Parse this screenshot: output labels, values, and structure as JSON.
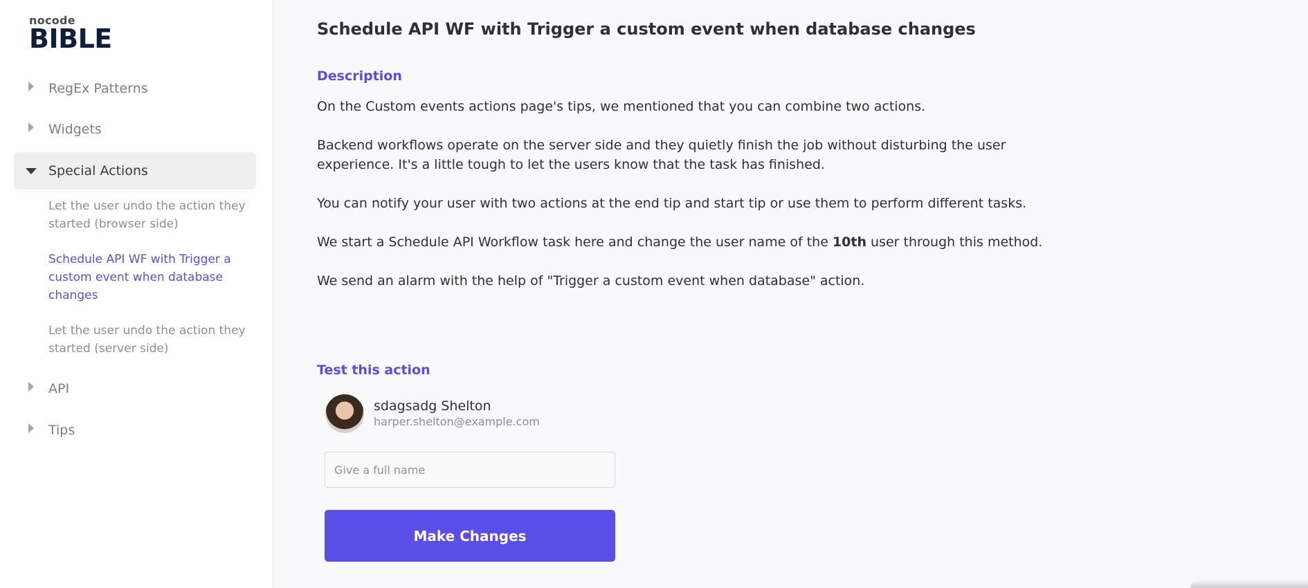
{
  "logo": {
    "small": "nocode",
    "big": "BIBLE"
  },
  "sidebar": {
    "items": [
      {
        "label": "RegEx Patterns",
        "expanded": false
      },
      {
        "label": "Widgets",
        "expanded": false
      },
      {
        "label": "Special Actions",
        "expanded": true,
        "children": [
          {
            "label": "Let the user undo the action they started (browser side)"
          },
          {
            "label": "Schedule API WF with Trigger a custom event when database changes",
            "current": true
          },
          {
            "label": "Let the user undo the action they started (server side)"
          }
        ]
      },
      {
        "label": "API",
        "expanded": false
      },
      {
        "label": "Tips",
        "expanded": false
      }
    ]
  },
  "main": {
    "title": "Schedule API WF with Trigger a custom event when database changes",
    "description_heading": "Description",
    "paragraphs": {
      "p1": "On the Custom events actions  page's tips, we mentioned that you can combine two actions.",
      "p2": "Backend workflows operate on the server side and they quietly finish the job without disturbing the user experience. It's a little tough to let the users know that the task has finished.",
      "p3": "You can notify your user with two actions at the end tip and start tip or use them to perform different tasks.",
      "p4_before": "We start a Schedule API Workflow task here and change the user name of the ",
      "p4_bold": "10th",
      "p4_after": " user through this method.",
      "p5": "We send an alarm with the help of \"Trigger a custom event when database\" action."
    },
    "test_heading": "Test this action",
    "user": {
      "name": "sdagsadg Shelton",
      "email": "harper.shelton@example.com"
    },
    "input": {
      "placeholder": "Give a full name",
      "value": ""
    },
    "button_label": "Make Changes"
  },
  "colors": {
    "accent": "#5a4de8",
    "link": "#5a4de0"
  }
}
